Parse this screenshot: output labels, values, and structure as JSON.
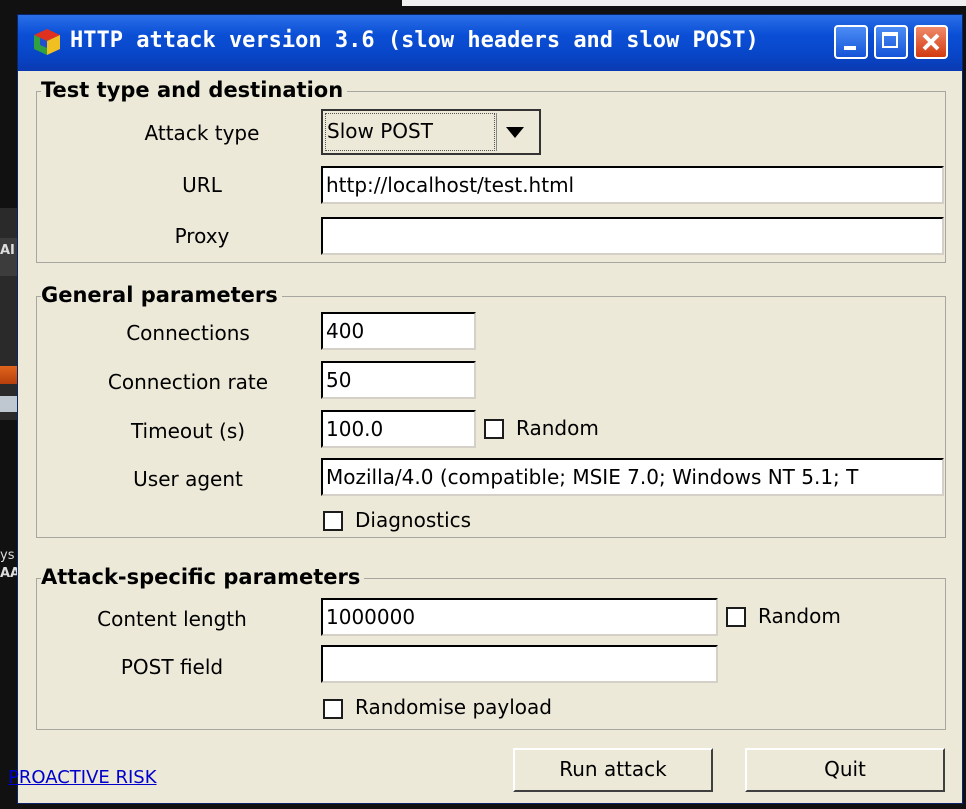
{
  "window": {
    "title": "HTTP attack version 3.6 (slow headers and slow POST)"
  },
  "background": {
    "frag1": "AI",
    "frag2": "ys",
    "frag3": "AA"
  },
  "test_group": {
    "title": "Test type and destination",
    "attack_type_label": "Attack type",
    "attack_type_value": "Slow POST",
    "url_label": "URL",
    "url_value": "http://localhost/test.html",
    "proxy_label": "Proxy",
    "proxy_value": ""
  },
  "general_group": {
    "title": "General parameters",
    "connections_label": "Connections",
    "connections_value": "400",
    "rate_label": "Connection rate",
    "rate_value": "50",
    "timeout_label": "Timeout (s)",
    "timeout_value": "100.0",
    "timeout_random_label": "Random",
    "useragent_label": "User agent",
    "useragent_value": "Mozilla/4.0 (compatible; MSIE 7.0; Windows NT 5.1; T",
    "diagnostics_label": "Diagnostics"
  },
  "attack_group": {
    "title": "Attack-specific parameters",
    "content_length_label": "Content length",
    "content_length_value": "1000000",
    "content_random_label": "Random",
    "post_field_label": "POST field",
    "post_field_value": "",
    "randomise_label": "Randomise payload"
  },
  "footer": {
    "link_text": "PROACTIVE RISK",
    "run_label": "Run attack",
    "quit_label": "Quit"
  },
  "colors": {
    "titlebar": "#0846c8",
    "window_bg": "#ece9d8",
    "link": "#0000cc"
  }
}
